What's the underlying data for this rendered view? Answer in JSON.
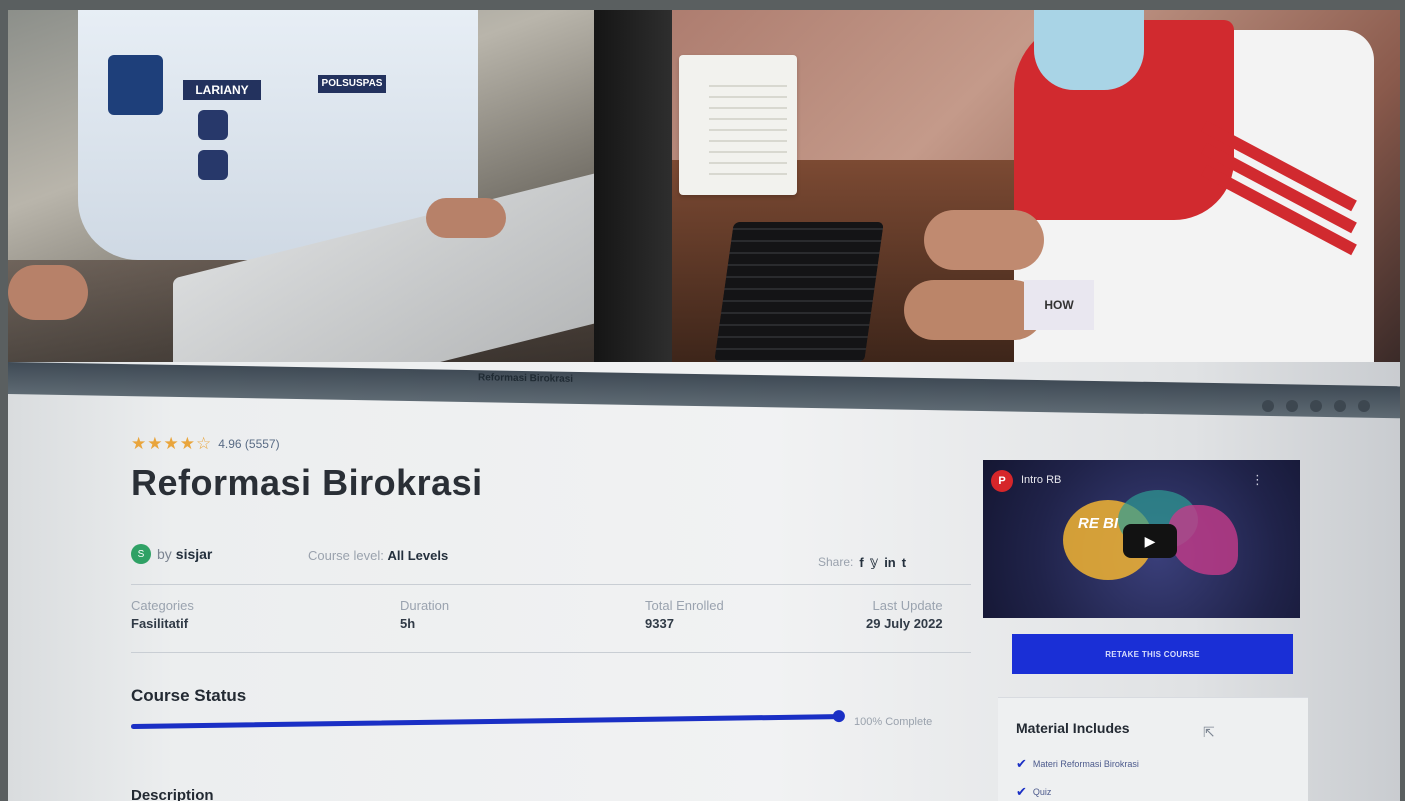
{
  "photos": {
    "left": {
      "name_tag": "LARIANY",
      "arm_badge": "POLSUSPAS"
    },
    "right": {
      "box_text": "HOW"
    }
  },
  "browser": {
    "tab_fragment": "Reformasi Birokrasi"
  },
  "course": {
    "rating_value": "4.96 (5557)",
    "stars": "★★★★☆",
    "title": "Reformasi Birokrasi",
    "author_initial": "S",
    "author_prefix": "by",
    "author": "sisjar",
    "level_label": "Course level:",
    "level_value": "All Levels",
    "share_label": "Share:",
    "share_icons": [
      "f",
      "𝕪",
      "in",
      "t"
    ],
    "meta": [
      {
        "label": "Categories",
        "value": "Fasilitatif"
      },
      {
        "label": "Duration",
        "value": "5h"
      },
      {
        "label": "Total Enrolled",
        "value": "9337"
      },
      {
        "label": "Last Update",
        "value": "29 July 2022"
      }
    ],
    "status_heading": "Course Status",
    "progress_percent": 100,
    "progress_text": "100% Complete",
    "next_heading": "Description"
  },
  "sidebar": {
    "video_logo": "P",
    "video_title": "Intro RB",
    "video_overlay": "RE BI",
    "retake_label": "RETAKE THIS COURSE",
    "materials_heading": "Material Includes",
    "materials": [
      "Materi Reformasi Birokrasi",
      "Quiz"
    ]
  },
  "colors": {
    "accent": "#1a2fd6",
    "star": "#e9a53c",
    "progress": "#1a2fc5"
  }
}
